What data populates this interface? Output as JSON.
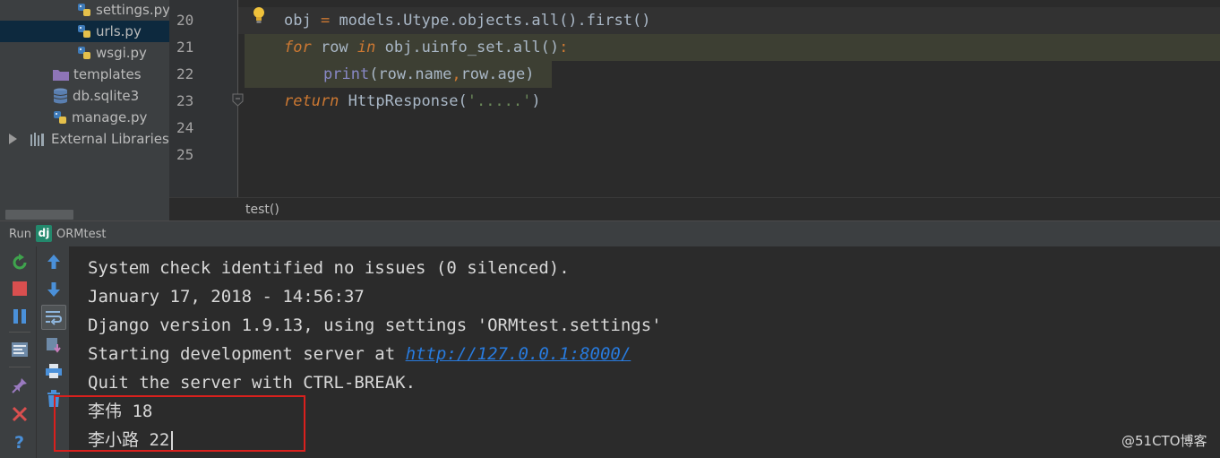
{
  "project_tree": {
    "items": [
      {
        "label": "settings.py",
        "type": "python-file"
      },
      {
        "label": "urls.py",
        "type": "python-file",
        "selected": true
      },
      {
        "label": "wsgi.py",
        "type": "python-file"
      },
      {
        "label": "templates",
        "type": "folder"
      },
      {
        "label": "db.sqlite3",
        "type": "database"
      },
      {
        "label": "manage.py",
        "type": "python-file"
      },
      {
        "label": "External Libraries",
        "type": "library",
        "collapsed": true
      }
    ]
  },
  "editor": {
    "line_numbers": [
      "20",
      "21",
      "22",
      "23",
      "24",
      "25"
    ],
    "code": {
      "l20": {
        "a": "obj ",
        "b": "=",
        "c": " models.Utype.objects.all().first()"
      },
      "l21": {
        "kw1": "for",
        "a": " row ",
        "kw2": "in",
        "b": " obj.uinfo_set.all()",
        "c": ":"
      },
      "l22": {
        "fn": "print",
        "a": "(row.name",
        "comma": ",",
        "b": "row.age)"
      },
      "l23": {
        "kw": "return",
        "a": " HttpResponse(",
        "str": "'.....'",
        "b": ")"
      }
    },
    "breadcrumb": "test()"
  },
  "run_panel": {
    "label": "Run",
    "config_icon": "dj",
    "config_name": "ORMtest",
    "console_lines": [
      "System check identified no issues (0 silenced).",
      "January 17, 2018 - 14:56:37",
      "Django version 1.9.13, using settings 'ORMtest.settings'"
    ],
    "server_line_prefix": "Starting development server at ",
    "server_url": "http://127.0.0.1:8000/",
    "quit_line": "Quit the server with CTRL-BREAK.",
    "output_lines": [
      "李伟 18",
      "李小路 22"
    ]
  },
  "watermark": "@51CTO博客",
  "colors": {
    "keyword": "#cc7832",
    "string": "#6a8759",
    "builtin": "#8888c6",
    "link": "#287bde",
    "highlight_box": "#d9201d"
  }
}
